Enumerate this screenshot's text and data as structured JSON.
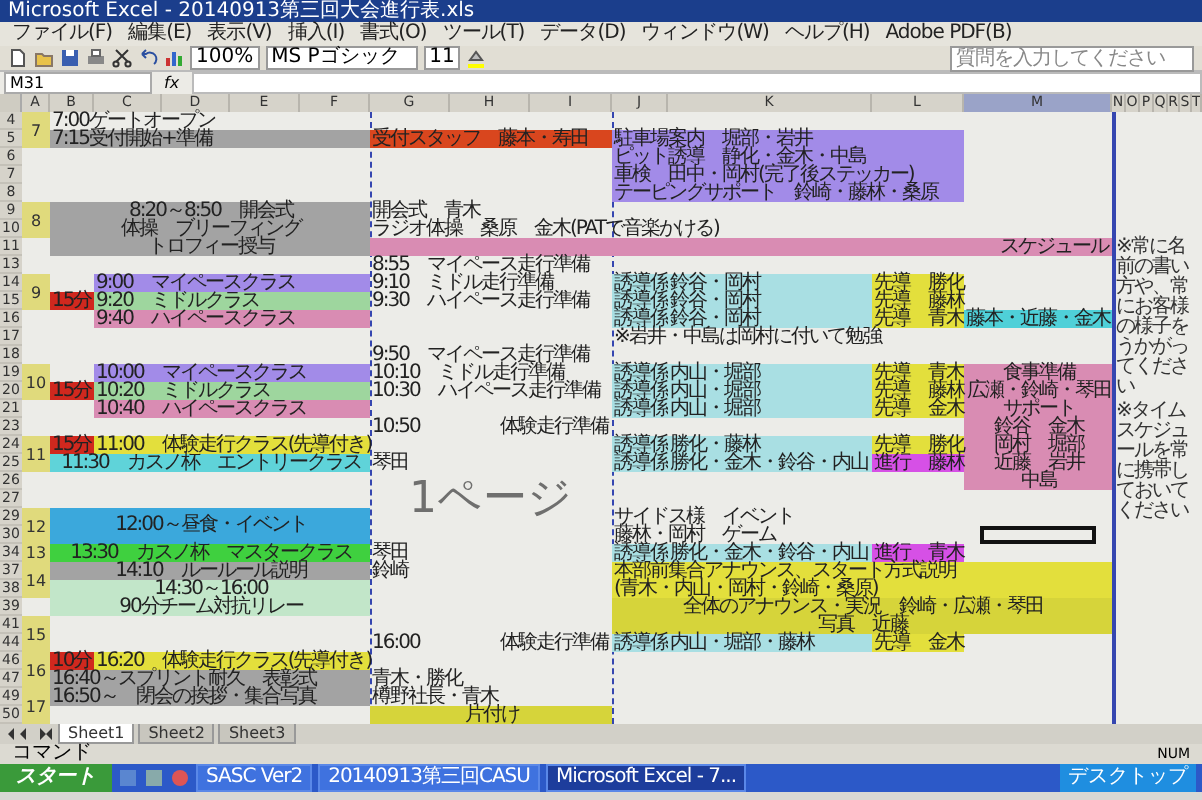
{
  "window": {
    "title": "Microsoft Excel - 20140913第三回大会進行表.xls"
  },
  "menu": [
    "ファイル(F)",
    "編集(E)",
    "表示(V)",
    "挿入(I)",
    "書式(O)",
    "ツール(T)",
    "データ(D)",
    "ウィンドウ(W)",
    "ヘルプ(H)",
    "Adobe PDF(B)"
  ],
  "toolbar": {
    "zoom": "100%",
    "font": "MS Pゴシック",
    "size": "11",
    "help_placeholder": "質問を入力してください"
  },
  "formula_bar": {
    "name_box": "M31",
    "fx": "fx"
  },
  "column_headers": [
    "A",
    "B",
    "C",
    "D",
    "E",
    "F",
    "G",
    "H",
    "I",
    "J",
    "K",
    "L",
    "M",
    "N",
    "O",
    "P",
    "Q",
    "R",
    "S",
    "T"
  ],
  "rows": [
    {
      "n": "4",
      "hour": "7",
      "cells": [
        {
          "kind": "event",
          "text": "7:00ゲートオープン"
        }
      ]
    },
    {
      "n": "5",
      "cells": [
        {
          "kind": "event",
          "text": "7:15受付開始+準備",
          "color": "#a3a3a3"
        },
        {
          "kind": "task",
          "text": "受付スタッフ　藤本・寿田",
          "color": "#d9461e"
        },
        {
          "kind": "team",
          "lines": [
            "駐車場案内　堀部・岩井",
            "ピット誘導　静化・金木・中島",
            "車検　田中・岡村(完了後ステッカー)",
            "テーピングサポート　鈴崎・藤林・桑原"
          ],
          "color": "#a28be8"
        }
      ]
    },
    {
      "n": "6",
      "cells": []
    },
    {
      "n": "7",
      "cells": []
    },
    {
      "n": "8",
      "cells": []
    },
    {
      "n": "9",
      "hour": "8",
      "cells": [
        {
          "kind": "banner",
          "lines": [
            "8:20～8:50　開会式",
            "体操　ブリーフィング",
            "トロフィー授与"
          ],
          "color": "#a3a3a3"
        },
        {
          "kind": "task",
          "text": "開会式　青木"
        }
      ]
    },
    {
      "n": "10",
      "cells": [
        {
          "kind": "note",
          "text": "ラジオ体操　桑原　金木(PATで音楽かける)"
        }
      ]
    },
    {
      "n": "11",
      "cells": [
        {
          "kind": "schedule",
          "text": "スケジュール",
          "color": "#d98cb3"
        }
      ]
    },
    {
      "n": "13",
      "cells": [
        {
          "kind": "task",
          "text": "8:55　マイペース走行準備"
        }
      ]
    },
    {
      "n": "14",
      "hour": "9",
      "cells": [
        {
          "kind": "class",
          "text": "9:00　マイペースクラス",
          "color": "#a28be8"
        },
        {
          "kind": "task",
          "text": "9:10　ミドル走行準備"
        },
        {
          "kind": "role",
          "text": "誘導係",
          "color": "#a9dfe3"
        },
        {
          "kind": "crew",
          "text": "鈴谷・岡村",
          "color": "#a9dfe3"
        },
        {
          "kind": "lead",
          "text": "先導　勝化",
          "color": "#e3df3c"
        }
      ]
    },
    {
      "n": "15",
      "cells": [
        {
          "kind": "fee",
          "text": "15分",
          "color": "#d0281e"
        },
        {
          "kind": "class",
          "text": "9:20　ミドルクラス",
          "color": "#9ed69e"
        },
        {
          "kind": "task",
          "text": "9:30　ハイペース走行準備"
        },
        {
          "kind": "role",
          "text": "誘導係",
          "color": "#a9dfe3"
        },
        {
          "kind": "crew",
          "text": "鈴谷・岡村",
          "color": "#a9dfe3"
        },
        {
          "kind": "lead",
          "text": "先導　藤林",
          "color": "#e3df3c"
        }
      ]
    },
    {
      "n": "16",
      "cells": [
        {
          "kind": "class",
          "text": "9:40　ハイペースクラス",
          "color": "#d98cb3"
        },
        {
          "kind": "role",
          "text": "誘導係",
          "color": "#a9dfe3"
        },
        {
          "kind": "crew",
          "text": "鈴谷・岡村",
          "color": "#a9dfe3"
        },
        {
          "kind": "lead",
          "text": "先導　青木",
          "color": "#e3df3c"
        },
        {
          "kind": "support",
          "text": "藤本・近藤・金木",
          "color": "#4fd0d8"
        }
      ]
    },
    {
      "n": "17",
      "cells": [
        {
          "kind": "memo",
          "text": "※岩井・中島は岡村に付いて勉強"
        }
      ]
    },
    {
      "n": "18",
      "cells": [
        {
          "kind": "task",
          "text": "9:50　マイペース走行準備"
        }
      ]
    },
    {
      "n": "19",
      "hour": "10",
      "cells": [
        {
          "kind": "class",
          "text": "10:00　マイペースクラス",
          "color": "#a28be8"
        },
        {
          "kind": "task",
          "text": "10:10　ミドル走行準備"
        },
        {
          "kind": "role",
          "text": "誘導係",
          "color": "#a9dfe3"
        },
        {
          "kind": "crew",
          "text": "内山・堀部",
          "color": "#a9dfe3"
        },
        {
          "kind": "lead",
          "text": "先導　青木",
          "color": "#e3df3c"
        },
        {
          "kind": "meal",
          "lines": [
            "食事準備",
            "広瀬・鈴崎・琴田",
            "サポート",
            "鈴谷　金木",
            "岡村　堀部",
            "近藤　岩井",
            "中島"
          ],
          "color": "#d98cb3"
        }
      ]
    },
    {
      "n": "20",
      "cells": [
        {
          "kind": "fee",
          "text": "15分",
          "color": "#d0281e"
        },
        {
          "kind": "class",
          "text": "10:20　ミドルクラス",
          "color": "#9ed69e"
        },
        {
          "kind": "task",
          "text": "10:30　ハイペース走行準備"
        },
        {
          "kind": "role",
          "text": "誘導係",
          "color": "#a9dfe3"
        },
        {
          "kind": "crew",
          "text": "内山・堀部",
          "color": "#a9dfe3"
        },
        {
          "kind": "lead",
          "text": "先導　藤林",
          "color": "#e3df3c"
        }
      ]
    },
    {
      "n": "21",
      "cells": [
        {
          "kind": "class",
          "text": "10:40　ハイペースクラス",
          "color": "#d98cb3"
        },
        {
          "kind": "role",
          "text": "誘導係",
          "color": "#a9dfe3"
        },
        {
          "kind": "crew",
          "text": "内山・堀部",
          "color": "#a9dfe3"
        },
        {
          "kind": "lead",
          "text": "先導　金木",
          "color": "#e3df3c"
        }
      ]
    },
    {
      "n": "23",
      "cells": [
        {
          "kind": "time",
          "text": "10:50"
        },
        {
          "kind": "prep",
          "text": "体験走行準備"
        }
      ]
    },
    {
      "n": "24",
      "hour": "11",
      "cells": [
        {
          "kind": "fee",
          "text": "15分",
          "color": "#d0281e"
        },
        {
          "kind": "trial",
          "text": "11:00　体験走行クラス(先導付き)",
          "color": "#e3df3c"
        },
        {
          "kind": "role",
          "text": "誘導係",
          "color": "#a9dfe3"
        },
        {
          "kind": "crew",
          "text": "勝化・藤林",
          "color": "#a9dfe3"
        },
        {
          "kind": "lead",
          "text": "先導　勝化",
          "color": "#e3df3c"
        }
      ]
    },
    {
      "n": "25",
      "cells": [
        {
          "kind": "banner",
          "text": "11:30　カスノ杯　エントリークラス",
          "color": "#5fd3d9"
        },
        {
          "kind": "task",
          "text": "琴田"
        },
        {
          "kind": "role",
          "text": "誘導係",
          "color": "#a9dfe3"
        },
        {
          "kind": "crew",
          "text": "勝化・金木・鈴谷・内山",
          "color": "#a9dfe3"
        },
        {
          "kind": "lead",
          "text": "進行　藤林",
          "color": "#d650e6"
        }
      ]
    },
    {
      "n": "26",
      "cells": []
    },
    {
      "n": "27",
      "cells": []
    },
    {
      "n": "29",
      "hour": "12",
      "cells": [
        {
          "kind": "bigbanner",
          "text": "12:00～昼食・イベント",
          "color": "#3ba8dc"
        },
        {
          "kind": "memo",
          "text": "サイドス様　イベント"
        }
      ]
    },
    {
      "n": "30",
      "cells": [
        {
          "kind": "memo",
          "text": "藤林・岡村　ゲーム"
        }
      ]
    },
    {
      "n": "34",
      "hour": "13",
      "cells": [
        {
          "kind": "banner",
          "text": "13:30　カスノ杯　マスタークラス",
          "color": "#3fd03f"
        },
        {
          "kind": "task",
          "text": "琴田"
        },
        {
          "kind": "role",
          "text": "誘導係",
          "color": "#a9dfe3"
        },
        {
          "kind": "crew",
          "text": "勝化・金木・鈴谷・内山",
          "color": "#a9dfe3"
        },
        {
          "kind": "lead",
          "text": "進行　青木",
          "color": "#d650e6"
        }
      ]
    },
    {
      "n": "37",
      "hour": "14",
      "cells": [
        {
          "kind": "banner",
          "text": "14:10　ルールール説明",
          "color": "#a3a3a3"
        },
        {
          "kind": "task",
          "text": "鈴崎"
        },
        {
          "kind": "announce",
          "lines": [
            "本部前集合アナウンス、スタート方式説明",
            "(青木・内山・岡村・鈴崎・桑原)"
          ],
          "color": "#e3df3c"
        }
      ]
    },
    {
      "n": "38",
      "cells": [
        {
          "kind": "banner",
          "lines": [
            "14:30～16:00",
            "90分チーム対抗リレー"
          ],
          "color": "#c2e6c9"
        }
      ]
    },
    {
      "n": "39",
      "cells": [
        {
          "kind": "broadcast",
          "lines": [
            "全体のアナウンス・実況　鈴崎・広瀬・琴田",
            "写真　近藤"
          ],
          "color": "#d6d43a"
        }
      ]
    },
    {
      "n": "41",
      "hour": "15",
      "cells": []
    },
    {
      "n": "44",
      "cells": [
        {
          "kind": "time",
          "text": "16:00"
        },
        {
          "kind": "prep",
          "text": "体験走行準備"
        },
        {
          "kind": "role",
          "text": "誘導係",
          "color": "#a9dfe3"
        },
        {
          "kind": "crew",
          "text": "内山・堀部・藤林",
          "color": "#a9dfe3"
        },
        {
          "kind": "lead",
          "text": "先導　金木",
          "color": "#e3df3c"
        }
      ]
    },
    {
      "n": "46",
      "hour": "16",
      "cells": [
        {
          "kind": "fee",
          "text": "10分",
          "color": "#d0281e"
        },
        {
          "kind": "trial",
          "text": "16:20　体験走行クラス(先導付き)",
          "color": "#e3df3c"
        }
      ]
    },
    {
      "n": "47",
      "cells": [
        {
          "kind": "event",
          "text": "16:40～スプリント耐久　表彰式",
          "color": "#a3a3a3"
        },
        {
          "kind": "task",
          "text": "青木・勝化"
        }
      ]
    },
    {
      "n": "49",
      "hour": "17",
      "cells": [
        {
          "kind": "event",
          "text": "16:50～　閉会の挨拶・集合写真",
          "color": "#a3a3a3"
        },
        {
          "kind": "task",
          "text": "樽野社長・青木"
        }
      ]
    },
    {
      "n": "50",
      "cells": [
        {
          "kind": "cleanup",
          "text": "片付け",
          "color": "#d6d43a"
        }
      ]
    }
  ],
  "page_label": "1ページ",
  "notes": [
    "※常に名前の書い方や、常にお客様の様子をうかがってください",
    "※タイムスケジュールを常に携帯しておいてください"
  ],
  "sheet_tabs": [
    {
      "label": "Sheet1",
      "selected": true
    },
    {
      "label": "Sheet2",
      "selected": false
    },
    {
      "label": "Sheet3",
      "selected": false
    }
  ],
  "status_bar": {
    "mode": "コマンド",
    "num": "NUM"
  },
  "taskbar": {
    "start": "スタート",
    "items": [
      {
        "label": "SASC Ver2",
        "selected": false
      },
      {
        "label": "20140913第三回CASU",
        "selected": false
      },
      {
        "label": "Microsoft Excel - 7...",
        "selected": true
      }
    ],
    "tray": "デスクトップ"
  }
}
